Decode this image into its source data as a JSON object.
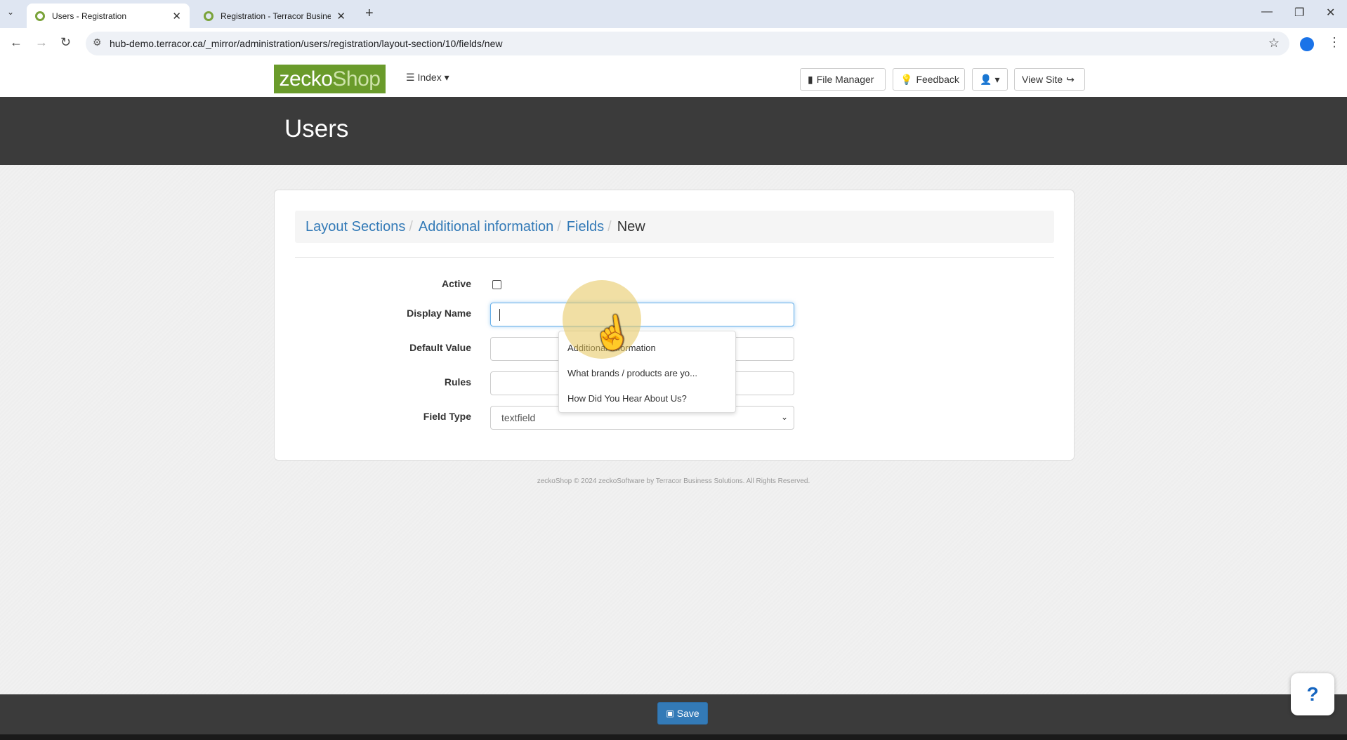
{
  "browser": {
    "tabs": [
      {
        "title": "Users - Registration",
        "active": true
      },
      {
        "title": "Registration - Terracor Business",
        "active": false
      }
    ],
    "url": "hub-demo.terracor.ca/_mirror/administration/users/registration/layout-section/10/fields/new"
  },
  "header": {
    "logo_main": "zecko",
    "logo_accent": "Shop",
    "index_label": "Index",
    "file_manager_label": "File Manager",
    "feedback_label": "Feedback",
    "view_site_label": "View Site"
  },
  "page": {
    "title": "Users"
  },
  "breadcrumb": {
    "items": [
      "Layout Sections",
      "Additional information",
      "Fields"
    ],
    "current": "New"
  },
  "form": {
    "active_label": "Active",
    "display_name_label": "Display Name",
    "display_name_value": "",
    "default_value_label": "Default Value",
    "rules_label": "Rules",
    "field_type_label": "Field Type",
    "field_type_value": "textfield"
  },
  "autocomplete": {
    "items": [
      "Additional Information",
      "What brands / products are yo...",
      "How Did You Hear About Us?"
    ]
  },
  "footer": {
    "text": "zeckoShop © 2024 zeckoSoftware by Terracor Business Solutions. All Rights Reserved."
  },
  "save_label": "Save",
  "help_label": "?",
  "colors": {
    "brand_green": "#6a9b2b",
    "link_blue": "#337ab7",
    "dark_band": "#3b3b3b"
  }
}
